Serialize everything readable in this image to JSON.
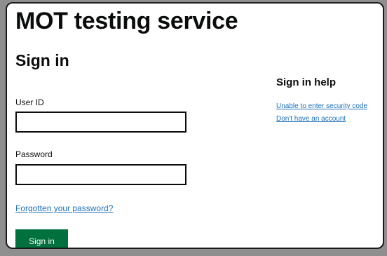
{
  "header": {
    "service_name": "MOT testing service"
  },
  "main": {
    "page_title": "Sign in",
    "user_id_label": "User ID",
    "user_id_value": "",
    "password_label": "Password",
    "password_value": "",
    "forgot_password_link": "Forgotten your password?",
    "sign_in_button": "Sign in"
  },
  "help": {
    "title": "Sign in help",
    "links": [
      "Unable to enter security code",
      "Don't have an account"
    ]
  },
  "colors": {
    "button_green": "#00703c",
    "link_blue": "#1d70b8",
    "text": "#0b0c0c"
  }
}
